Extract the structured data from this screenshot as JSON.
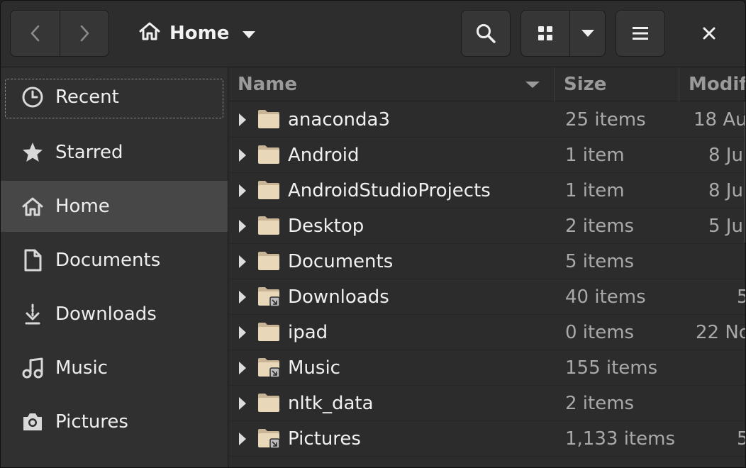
{
  "header": {
    "path_label": "Home",
    "icons": {
      "back": "go-previous-icon",
      "forward": "go-next-icon",
      "home": "home-icon",
      "path_dropdown": "pan-down-icon",
      "search": "search-icon",
      "view_grid": "view-grid-icon",
      "view_dropdown": "pan-down-icon",
      "menu": "open-menu-icon",
      "close": "window-close-icon"
    }
  },
  "sidebar": {
    "items": [
      {
        "label": "Recent",
        "icon": "clock-icon"
      },
      {
        "label": "Starred",
        "icon": "star-icon"
      },
      {
        "label": "Home",
        "icon": "home-icon"
      },
      {
        "label": "Documents",
        "icon": "document-icon"
      },
      {
        "label": "Downloads",
        "icon": "download-icon"
      },
      {
        "label": "Music",
        "icon": "music-note-icon"
      },
      {
        "label": "Pictures",
        "icon": "camera-icon"
      }
    ],
    "selected": "Home"
  },
  "filelist": {
    "columns": {
      "name": "Name",
      "size": "Size",
      "modified": "Modif"
    },
    "rows": [
      {
        "name": "anaconda3",
        "size": "25 items",
        "modified": "18 Au"
      },
      {
        "name": "Android",
        "size": "1 item",
        "modified": "8 Ju"
      },
      {
        "name": "AndroidStudioProjects",
        "size": "1 item",
        "modified": "8 Ju"
      },
      {
        "name": "Desktop",
        "size": "2 items",
        "modified": "5 Ju"
      },
      {
        "name": "Documents",
        "size": "5 items",
        "modified": ""
      },
      {
        "name": "Downloads",
        "size": "40 items",
        "modified": "5"
      },
      {
        "name": "ipad",
        "size": "0 items",
        "modified": "22 No"
      },
      {
        "name": "Music",
        "size": "155 items",
        "modified": ""
      },
      {
        "name": "nltk_data",
        "size": "2 items",
        "modified": ""
      },
      {
        "name": "Pictures",
        "size": "1,133 items",
        "modified": "5"
      }
    ]
  },
  "colors": {
    "folder": "#e8d7b8",
    "folder_dark": "#c9b595",
    "background": "#2c2c2c",
    "sidebar": "#303030",
    "selected": "#474747"
  }
}
